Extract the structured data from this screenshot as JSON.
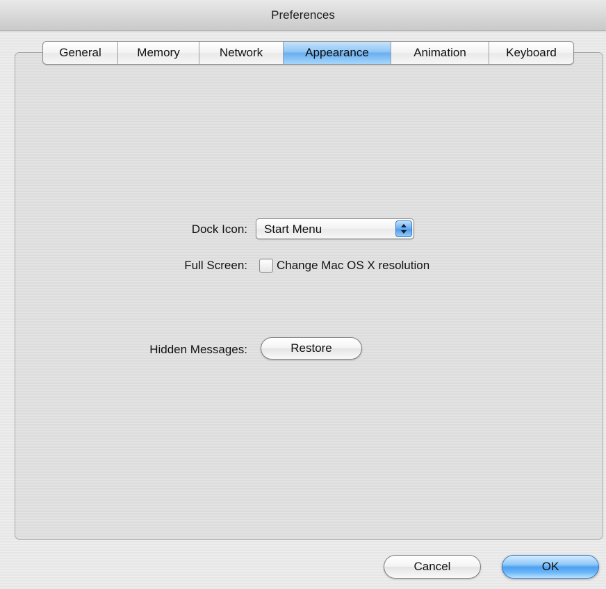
{
  "window": {
    "title": "Preferences"
  },
  "tabs": [
    {
      "label": "General",
      "active": false
    },
    {
      "label": "Memory",
      "active": false
    },
    {
      "label": "Network",
      "active": false
    },
    {
      "label": "Appearance",
      "active": true
    },
    {
      "label": "Animation",
      "active": false
    },
    {
      "label": "Keyboard",
      "active": false
    }
  ],
  "appearance": {
    "dock_icon": {
      "label": "Dock Icon:",
      "value": "Start Menu"
    },
    "full_screen": {
      "label": "Full Screen:",
      "checkbox_label": "Change Mac OS X resolution",
      "checked": false
    },
    "hidden_messages": {
      "label": "Hidden Messages:",
      "button_label": "Restore"
    }
  },
  "footer": {
    "cancel_label": "Cancel",
    "ok_label": "OK"
  },
  "colors": {
    "accent": "#6aaef0",
    "window_bg": "#ececec"
  }
}
